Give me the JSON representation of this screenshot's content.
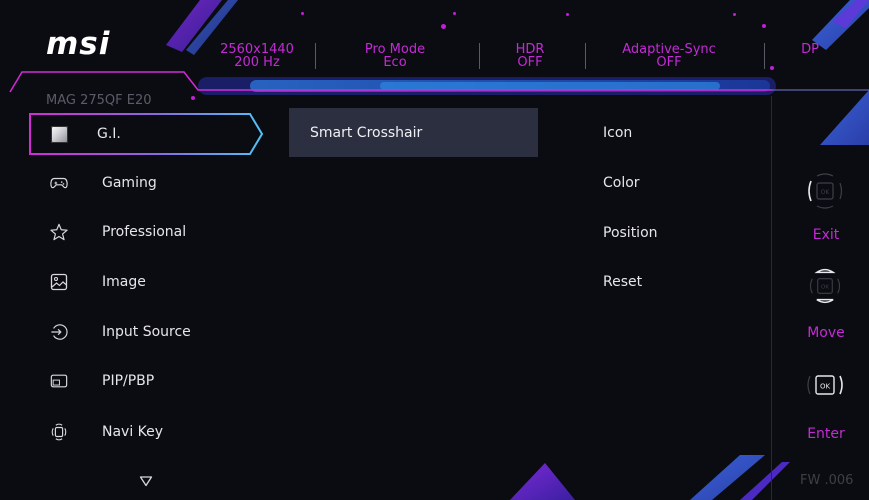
{
  "header": {
    "logo": "msi",
    "status": [
      {
        "line1": "2560x1440",
        "line2": "200 Hz"
      },
      {
        "line1": "Pro Mode",
        "line2": "Eco"
      },
      {
        "line1": "HDR",
        "line2": "OFF"
      },
      {
        "line1": "Adaptive-Sync",
        "line2": "OFF"
      },
      {
        "line1": "DP",
        "line2": ""
      }
    ],
    "model": "MAG 275QF E20"
  },
  "menu": {
    "items": [
      {
        "label": "G.I.",
        "icon": "gi-icon",
        "active": true
      },
      {
        "label": "Gaming",
        "icon": "gamepad-icon"
      },
      {
        "label": "Professional",
        "icon": "star-icon"
      },
      {
        "label": "Image",
        "icon": "image-icon"
      },
      {
        "label": "Input Source",
        "icon": "input-source-icon"
      },
      {
        "label": "PIP/PBP",
        "icon": "pip-icon"
      },
      {
        "label": "Navi Key",
        "icon": "navi-key-icon"
      }
    ],
    "more_icon": "chevron-down-icon"
  },
  "submenu": {
    "items": [
      {
        "label": "Smart Crosshair",
        "selected": true
      }
    ]
  },
  "options": {
    "items": [
      {
        "label": "Icon"
      },
      {
        "label": "Color"
      },
      {
        "label": "Position"
      },
      {
        "label": "Reset"
      }
    ]
  },
  "keys": [
    {
      "label": "Exit",
      "icon": "navi-left-icon"
    },
    {
      "label": "Move",
      "icon": "navi-updown-icon"
    },
    {
      "label": "Enter",
      "icon": "navi-ok-icon"
    }
  ],
  "firmware": "FW .006",
  "colors": {
    "accent": "#c52ad6",
    "highlight_border": "#4fc3f7",
    "selected_bg": "#2c2f3f",
    "background": "#0b0c12"
  }
}
